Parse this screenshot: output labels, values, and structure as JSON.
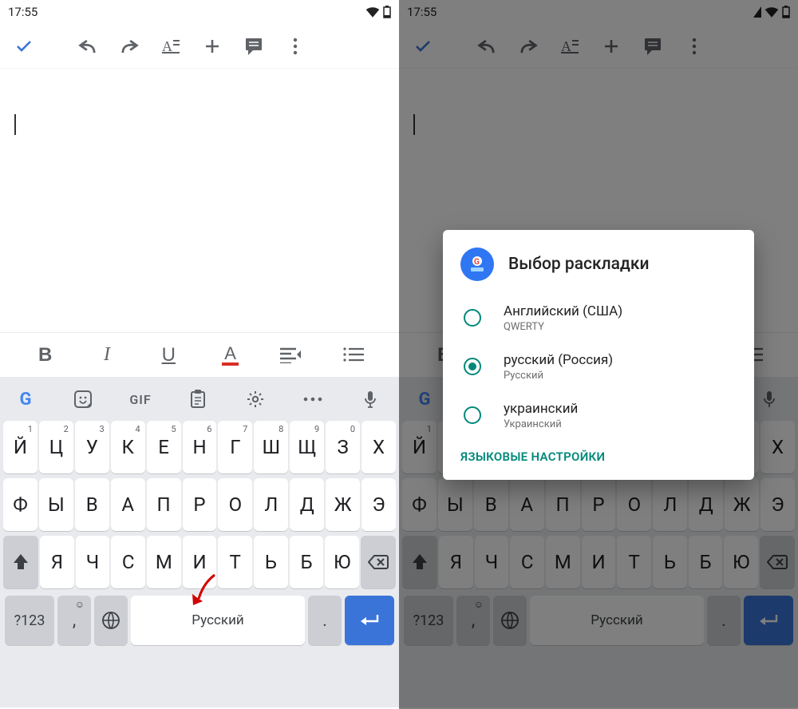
{
  "status": {
    "time": "17:55"
  },
  "keyboard": {
    "strip": {
      "gif": "GIF"
    },
    "row1": [
      {
        "k": "Й",
        "s": "1"
      },
      {
        "k": "Ц",
        "s": "2"
      },
      {
        "k": "У",
        "s": "3"
      },
      {
        "k": "К",
        "s": "4"
      },
      {
        "k": "Е",
        "s": "5"
      },
      {
        "k": "Н",
        "s": "6"
      },
      {
        "k": "Г",
        "s": "7"
      },
      {
        "k": "Ш",
        "s": "8"
      },
      {
        "k": "Щ",
        "s": "9"
      },
      {
        "k": "З",
        "s": "0"
      },
      {
        "k": "Х",
        "s": ""
      }
    ],
    "row2": [
      "Ф",
      "Ы",
      "В",
      "А",
      "П",
      "Р",
      "О",
      "Л",
      "Д",
      "Ж",
      "Э"
    ],
    "row3": [
      "Я",
      "Ч",
      "С",
      "М",
      "И",
      "Т",
      "Ь",
      "Б",
      "Ю"
    ],
    "sym_label": "?123",
    "space_label": "Русский",
    "dot": ".",
    "comma": ","
  },
  "dialog": {
    "title": "Выбор раскладки",
    "options": [
      {
        "title": "Английский (США)",
        "sub": "QWERTY",
        "selected": false
      },
      {
        "title": "русский (Россия)",
        "sub": "Русский",
        "selected": true
      },
      {
        "title": "украинский",
        "sub": "Украинский",
        "selected": false
      }
    ],
    "footer": "ЯЗЫКОВЫЕ НАСТРОЙКИ"
  }
}
